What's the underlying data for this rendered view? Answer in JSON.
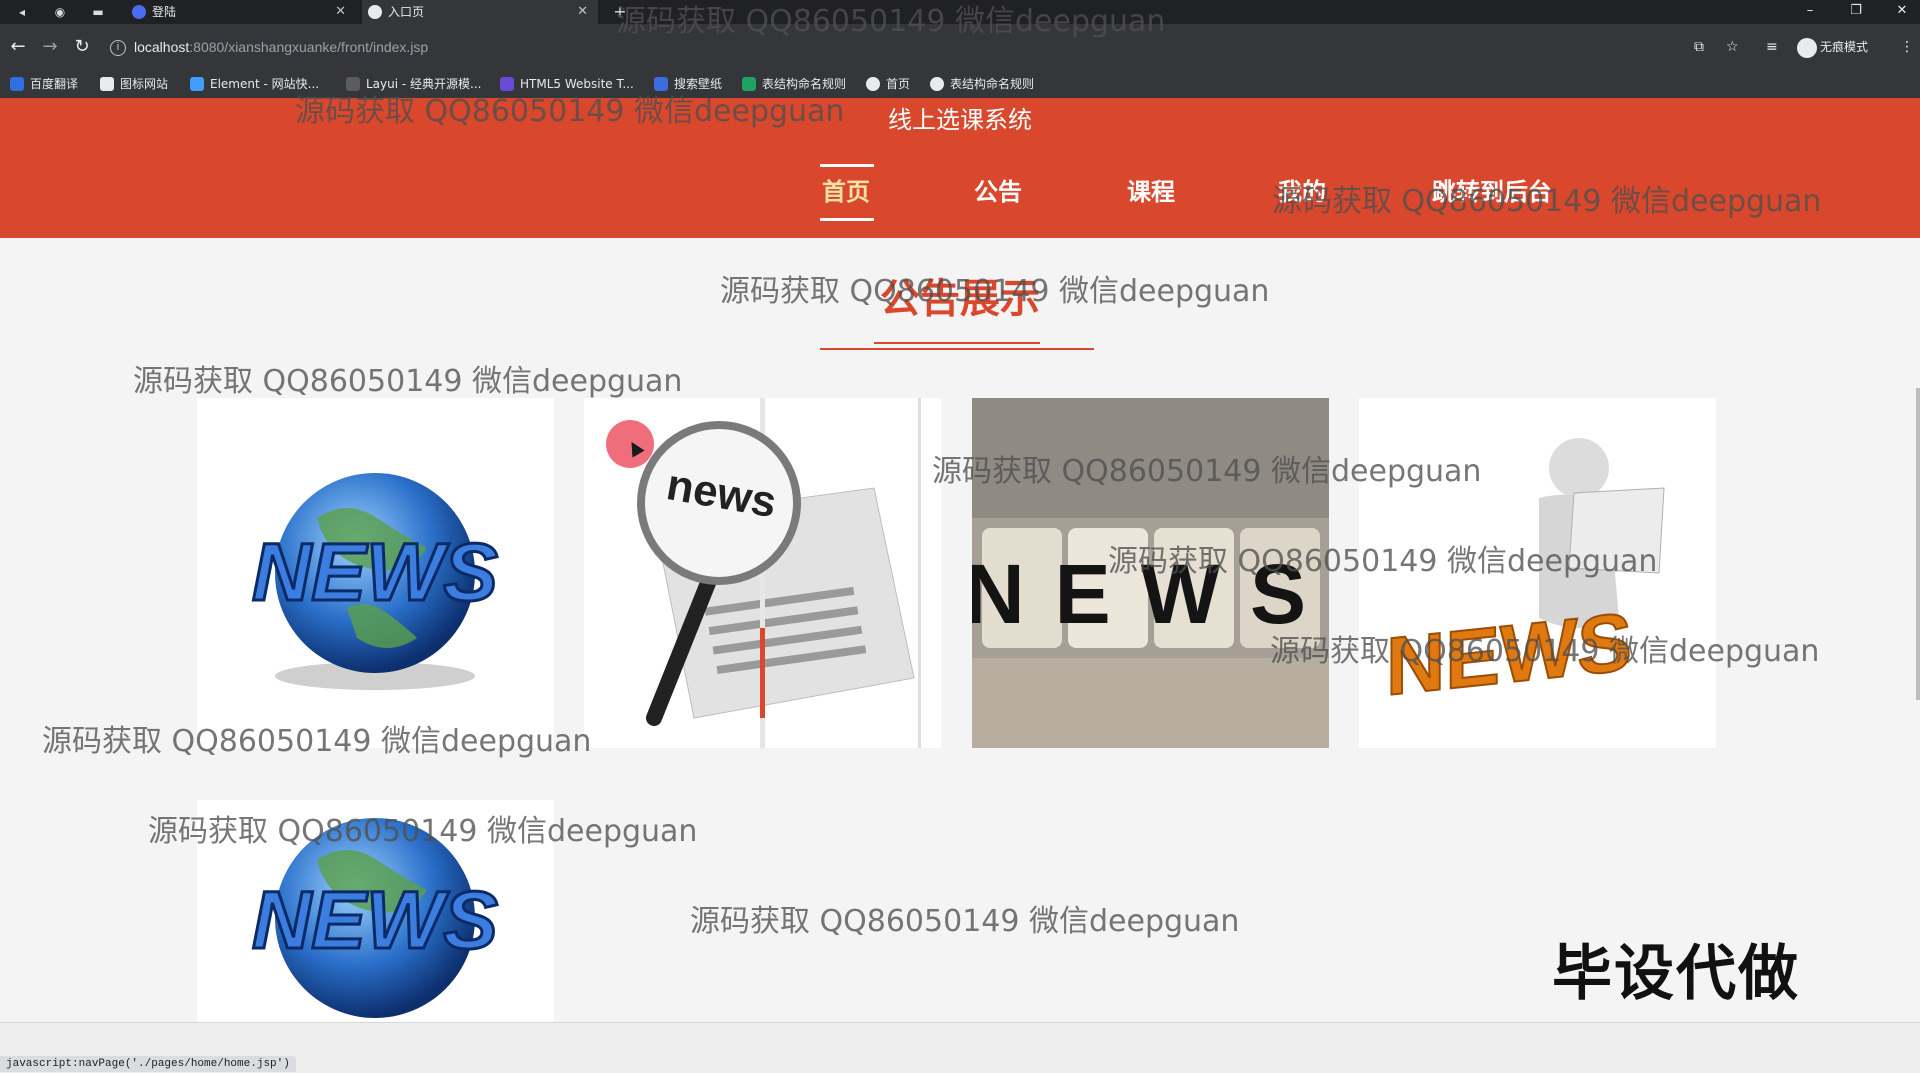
{
  "browser": {
    "tabs": [
      {
        "title": "登陆",
        "active": false
      },
      {
        "title": "入口页",
        "active": true
      }
    ],
    "new_tab": "+",
    "url_host": "localhost",
    "url_path": ":8080/xianshangxuanke/front/index.jsp",
    "bookmarks": [
      "百度翻译",
      "图标网站",
      "Element - 网站快...",
      "Layui - 经典开源模...",
      "HTML5 Website T...",
      "搜索壁纸",
      "表结构命名规则",
      "首页",
      "表结构命名规则"
    ],
    "incognito_label": "无痕模式",
    "status_text": "javascript:navPage('./pages/home/home.jsp')"
  },
  "site": {
    "title": "线上选课系统",
    "nav": [
      {
        "label": "首页",
        "active": true
      },
      {
        "label": "公告",
        "active": false
      },
      {
        "label": "课程",
        "active": false
      },
      {
        "label": "我的",
        "active": false
      },
      {
        "label": "跳转到后台",
        "active": false
      }
    ],
    "section_title": "公告展示"
  },
  "cards": [
    {
      "image": "news-globe-image",
      "text": "NEWS"
    },
    {
      "image": "magnifier-newspaper-image",
      "text": "news"
    },
    {
      "image": "news-dice-image",
      "text": "NEWS"
    },
    {
      "image": "figure-reading-news-image",
      "text": "NEWS"
    },
    {
      "image": "news-globe-image",
      "text": "NEWS"
    }
  ],
  "overlay": {
    "watermark": "源码获取 QQ86050149 微信deepguan",
    "corner_text": "毕设代做"
  },
  "colors": {
    "header_red": "#d9472c",
    "active_nav": "#ffe3a8",
    "chrome_dark": "#35363a"
  }
}
